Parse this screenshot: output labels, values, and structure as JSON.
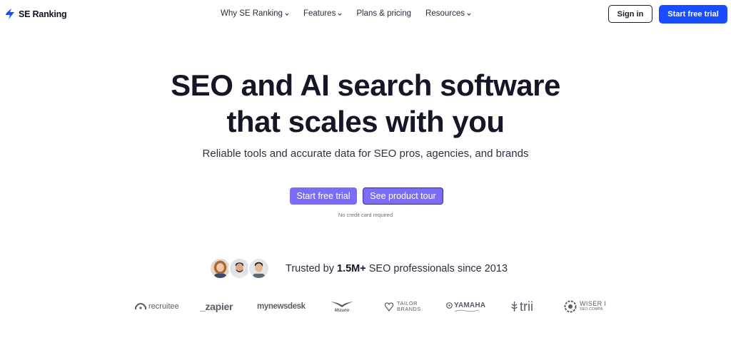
{
  "brand": {
    "name": "SE Ranking",
    "accent": "#1a4dff",
    "cta_purple": "#7b6cf6"
  },
  "nav": {
    "menu": [
      {
        "label": "Why SE Ranking",
        "has_dropdown": true
      },
      {
        "label": "Features",
        "has_dropdown": true
      },
      {
        "label": "Plans & pricing",
        "has_dropdown": false
      },
      {
        "label": "Resources",
        "has_dropdown": true
      }
    ],
    "sign_in": "Sign in",
    "start_trial": "Start free trial"
  },
  "hero": {
    "title_line1": "SEO and AI search software",
    "title_line2": "that scales with you",
    "subtitle": "Reliable tools and accurate data for SEO pros, agencies, and brands",
    "cta_primary": "Start free trial",
    "cta_secondary": "See product tour",
    "note": "No credit card required"
  },
  "trust": {
    "prefix": "Trusted by ",
    "count": "1.5M+",
    "suffix": " SEO professionals since 2013",
    "avatars": [
      "avatar-woman",
      "avatar-man-1",
      "avatar-man-2"
    ]
  },
  "logos": {
    "recruitee": "recruitee",
    "zapier": "_zapier",
    "mynewsdesk": "mynewsdesk",
    "mizuno": "Mizuno",
    "tailor_line1": "TAILOR",
    "tailor_line2": "BRANDS",
    "yamaha": "YAMAHA",
    "trii": "trii",
    "wiser_line1": "WISER I",
    "wiser_line2": "SEO COMPA"
  }
}
